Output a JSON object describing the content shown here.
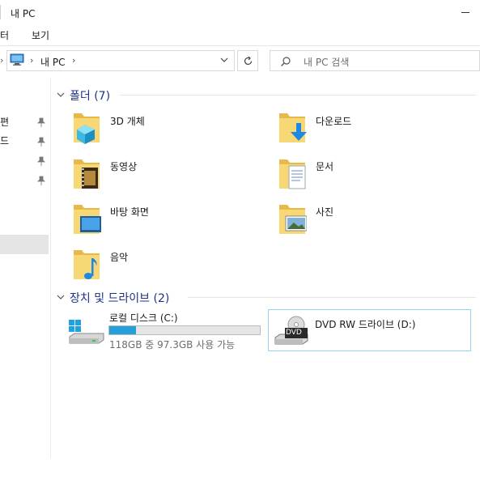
{
  "window": {
    "title": "내 PC"
  },
  "ribbon": {
    "tabs": [
      "터",
      "보기"
    ]
  },
  "address": {
    "breadcrumb": "내 PC",
    "search_placeholder": "내 PC 검색"
  },
  "nav": {
    "items": [
      "편",
      "드",
      "",
      ""
    ]
  },
  "groups": {
    "folders": {
      "header": "폴더 (7)"
    },
    "drives": {
      "header": "장치 및 드라이브 (2)"
    }
  },
  "folders": [
    {
      "label": "3D 개체",
      "icon": "3d-objects-folder-icon"
    },
    {
      "label": "다운로드",
      "icon": "downloads-folder-icon"
    },
    {
      "label": "동영상",
      "icon": "videos-folder-icon"
    },
    {
      "label": "문서",
      "icon": "documents-folder-icon"
    },
    {
      "label": "바탕 화면",
      "icon": "desktop-folder-icon"
    },
    {
      "label": "사진",
      "icon": "pictures-folder-icon"
    },
    {
      "label": "음악",
      "icon": "music-folder-icon"
    }
  ],
  "drives": [
    {
      "label": "로컬 디스크 (C:)",
      "sub": "118GB 중 97.3GB 사용 가능",
      "used_fraction": 0.18,
      "icon": "windows-drive-icon"
    },
    {
      "label": "DVD RW 드라이브 (D:)",
      "badge": "DVD",
      "icon": "dvd-drive-icon"
    }
  ],
  "colors": {
    "accent": "#26a0da",
    "header": "#1e3287",
    "folder": "#f8d775",
    "selection_border": "#99d1ef"
  }
}
